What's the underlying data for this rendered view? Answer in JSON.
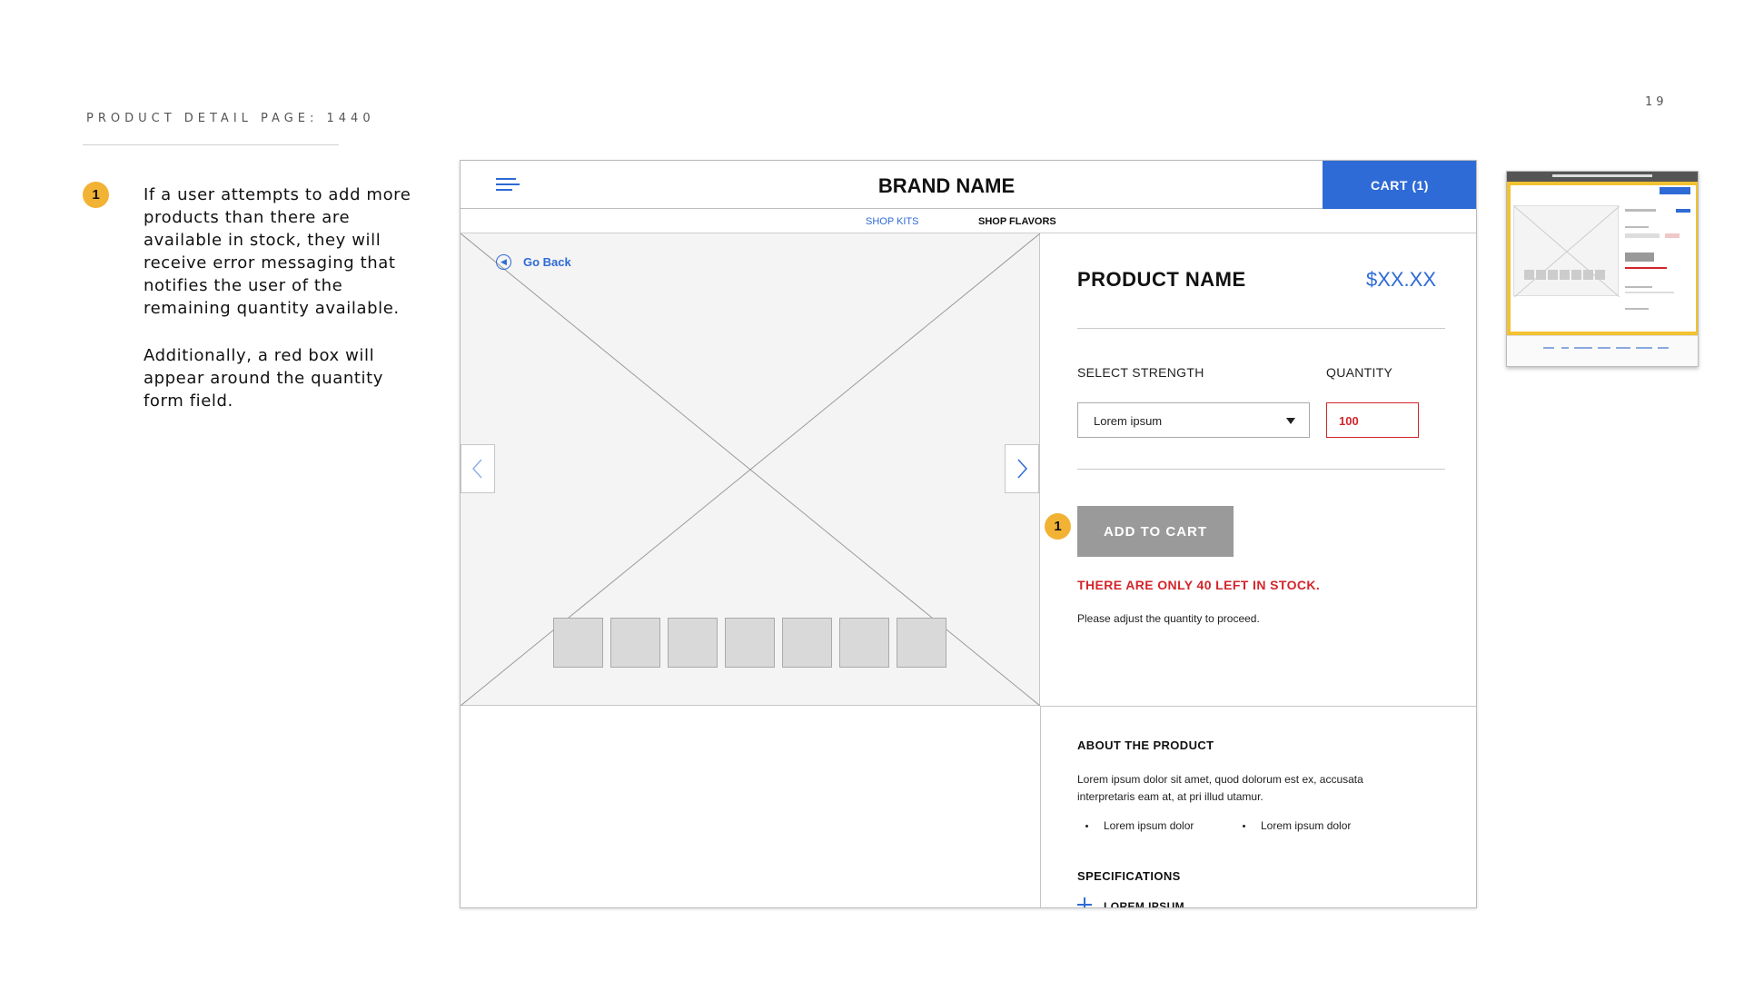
{
  "slide": {
    "title": "PRODUCT DETAIL PAGE: 1440",
    "page_number": "19"
  },
  "notes": {
    "badge": "1",
    "paragraph_1": "If a user attempts to add more\nproducts than there are\navailable in stock, they will\nreceive error messaging that\nnotifies the user of the\nremaining quantity available.",
    "paragraph_2": "Additionally, a red box will\nappear around the quantity\nform field."
  },
  "header": {
    "menu_icon": "hamburger-menu-icon",
    "brand": "BRAND NAME",
    "cart_label": "CART (1)"
  },
  "subnav": {
    "tabs": [
      {
        "label": "SHOP KITS",
        "active": false
      },
      {
        "label": "SHOP FLAVORS",
        "active": true
      }
    ]
  },
  "gallery": {
    "go_back": "Go Back",
    "thumbnail_count": 7
  },
  "product": {
    "name": "PRODUCT NAME",
    "price": "$XX.XX",
    "strength_label": "SELECT STRENGTH",
    "strength_value": "Lorem ipsum",
    "quantity_label": "QUANTITY",
    "quantity_value": "100",
    "add_badge": "1",
    "add_to_cart": "ADD TO CART",
    "error": "THERE ARE ONLY 40 LEFT IN STOCK.",
    "hint": "Please adjust the quantity to proceed."
  },
  "about": {
    "heading": "ABOUT THE PRODUCT",
    "text": "Lorem ipsum dolor sit amet, quod dolorum est ex, accusata interpretaris eam at, at pri illud utamur.",
    "bullets": [
      "Lorem ipsum dolor",
      "Lorem ipsum dolor"
    ]
  },
  "specifications": {
    "heading": "SPECIFICATIONS",
    "item": "LOREM IPSUM"
  },
  "colors": {
    "accent_blue": "#2e6bd6",
    "error_red": "#d3252b",
    "badge_yellow": "#f2b233",
    "button_gray": "#9a9a9a"
  }
}
